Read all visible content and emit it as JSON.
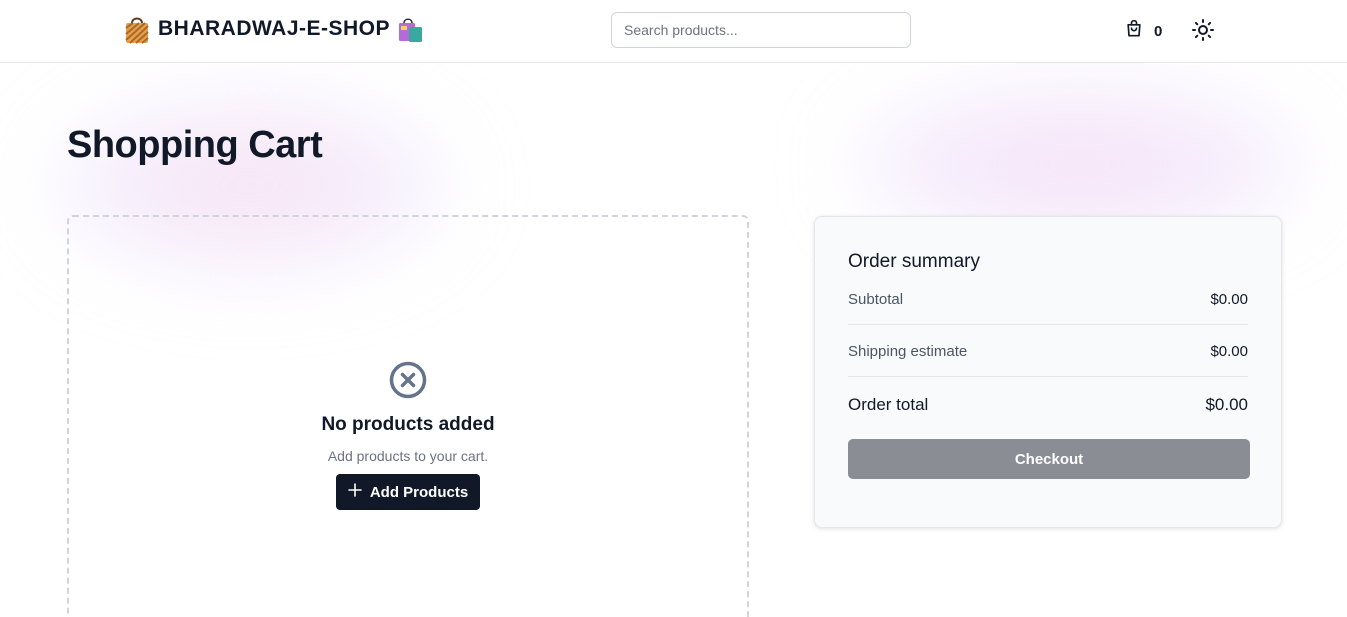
{
  "header": {
    "brand": "BHARADWAJ-E-SHOP",
    "search_placeholder": "Search products...",
    "cart_count": "0"
  },
  "icons": {
    "brand_left": "shopping-bag-icon",
    "brand_right": "shopping-bags-icon",
    "cart": "cart-bag-icon",
    "theme": "sun-icon",
    "empty": "circle-x-icon",
    "add": "plus-icon"
  },
  "page": {
    "title": "Shopping Cart"
  },
  "empty_state": {
    "title": "No products added",
    "subtitle": "Add products to your cart.",
    "button_label": "Add Products"
  },
  "summary": {
    "title": "Order summary",
    "subtotal_label": "Subtotal",
    "subtotal_value": "$0.00",
    "shipping_label": "Shipping estimate",
    "shipping_value": "$0.00",
    "total_label": "Order total",
    "total_value": "$0.00",
    "checkout_label": "Checkout"
  },
  "colors": {
    "primary_dark": "#111827",
    "checkout_disabled": "#8a8d94",
    "summary_bg": "#f9fafb"
  }
}
